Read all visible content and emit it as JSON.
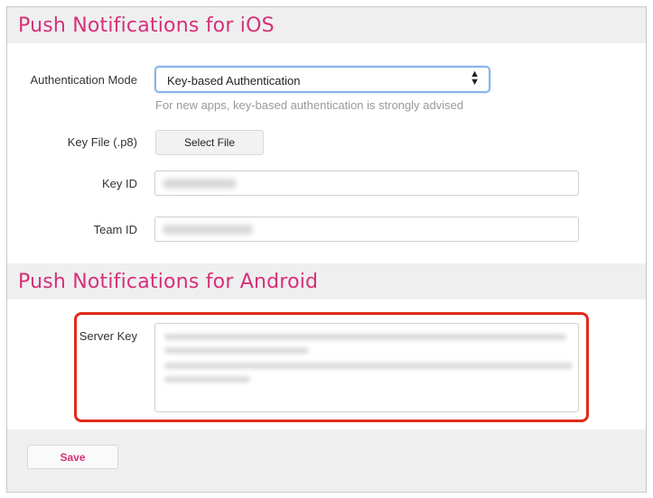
{
  "ios_section": {
    "title": "Push Notifications for iOS",
    "auth_mode": {
      "label": "Authentication Mode",
      "value": "Key-based Authentication",
      "hint": "For new apps, key-based authentication is strongly advised"
    },
    "key_file": {
      "label": "Key File (.p8)",
      "button_label": "Select File"
    },
    "key_id": {
      "label": "Key ID"
    },
    "team_id": {
      "label": "Team ID"
    }
  },
  "android_section": {
    "title": "Push Notifications for Android",
    "server_key": {
      "label": "Server Key"
    }
  },
  "footer": {
    "save_label": "Save"
  },
  "colors": {
    "accent": "#d6307a",
    "highlight": "#e02a1a",
    "section_bg": "#efefef",
    "focus_border": "#8ab3e8"
  },
  "icons": {
    "select_arrows": "up-down-arrows-icon"
  }
}
